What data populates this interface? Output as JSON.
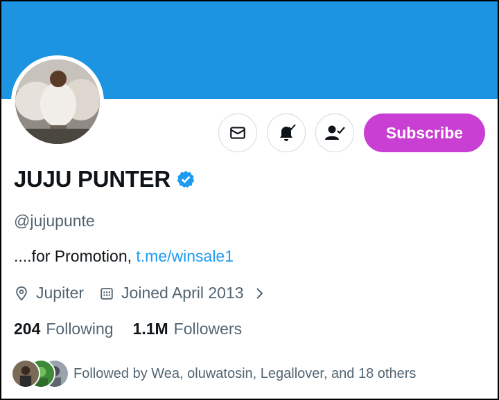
{
  "profile": {
    "display_name": "JUJU PUNTER",
    "handle": "@jujupunte",
    "bio_text": "....for Promotion, ",
    "bio_link": "t.me/winsale1",
    "location": "Jupiter",
    "joined": "Joined April 2013"
  },
  "actions": {
    "message_icon": "mail-icon",
    "notify_icon": "bell-check-icon",
    "following_icon": "person-check-icon",
    "subscribe_label": "Subscribe"
  },
  "stats": {
    "following_count": "204",
    "following_label": "Following",
    "followers_count": "1.1M",
    "followers_label": "Followers"
  },
  "followed_by": {
    "text": "Followed by Wea, oluwatosin, Legallover, and 18 others"
  },
  "colors": {
    "banner": "#1d94e2",
    "subscribe": "#c93fd3",
    "link": "#1d9bf0",
    "verified": "#1d9bf0",
    "secondary_text": "#536471"
  }
}
